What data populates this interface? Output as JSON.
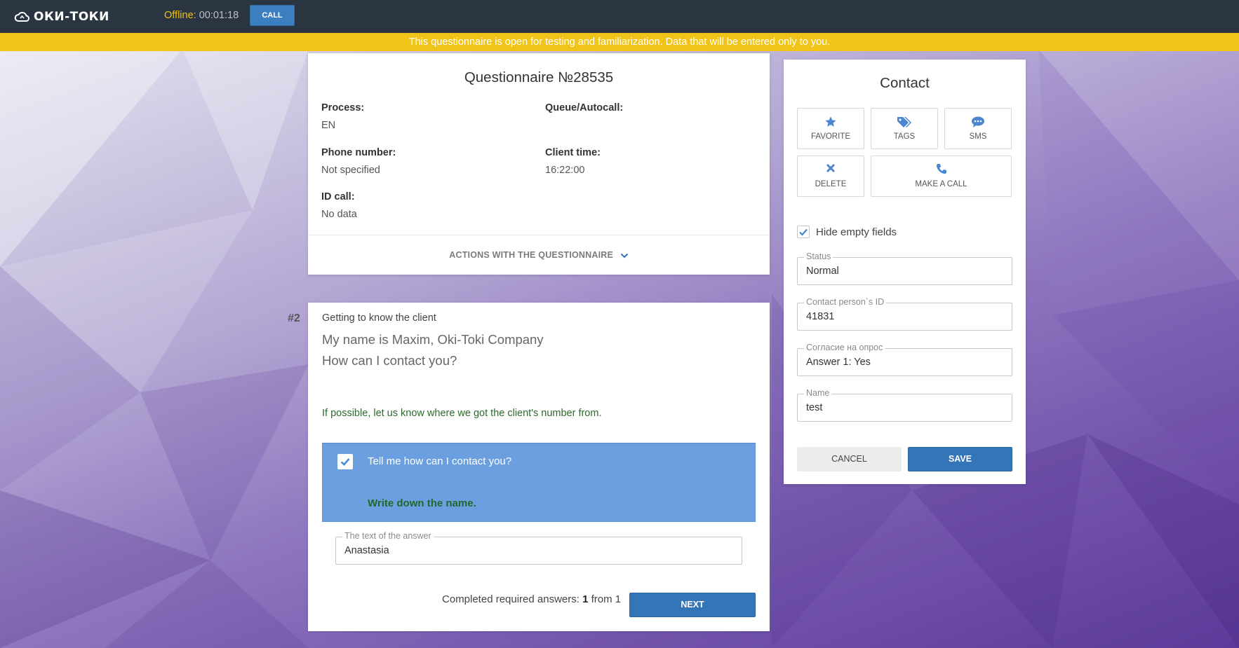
{
  "app": {
    "logo_text": "ОКИ-ТОКИ",
    "offline_label": "Offline:",
    "offline_time": "00:01:18",
    "call_label": "CALL"
  },
  "banner": {
    "text": "This questionnaire is open for testing and familiarization. Data that will be entered only to you.",
    "color": "#f0c419"
  },
  "questionnaire": {
    "title": "Questionnaire №28535",
    "fields": {
      "process_label": "Process:",
      "process_value": "EN",
      "queue_label": "Queue/Autocall:",
      "queue_value": "",
      "phone_label": "Phone number:",
      "phone_value": "Not specified",
      "client_time_label": "Client time:",
      "client_time_value": "16:22:00",
      "id_call_label": "ID call:",
      "id_call_value": "No data"
    },
    "actions_label": "ACTIONS WITH THE QUESTIONNAIRE"
  },
  "question": {
    "number": "#2",
    "section": "Getting to know the client",
    "text_line1": "My name is Maxim, Oki-Toki Company",
    "text_line2": "How can I contact you?",
    "hint": "If possible, let us know where we got the client's number from.",
    "answer_option": "Tell me how can I contact you?",
    "answer_instruction": "Write down the name.",
    "answer_field_label": "The text of the answer",
    "answer_field_value": "Anastasia",
    "completed_prefix": "Completed required answers:",
    "completed_count": "1",
    "completed_suffix": "from 1",
    "next_label": "NEXT"
  },
  "contact": {
    "title": "Contact",
    "buttons": {
      "favorite": "FAVORITE",
      "tags": "TAGS",
      "sms": "SMS",
      "delete": "DELETE",
      "make_call": "MAKE A CALL"
    },
    "hide_empty_label": "Hide empty fields",
    "hide_empty_checked": true,
    "fields": [
      {
        "label": "Status",
        "value": "Normal"
      },
      {
        "label": "Contact person`s ID",
        "value": "41831"
      },
      {
        "label": "Согласие на опрос",
        "value": "Answer 1: Yes"
      },
      {
        "label": "Name",
        "value": "test"
      }
    ],
    "cancel_label": "CANCEL",
    "save_label": "SAVE"
  },
  "colors": {
    "topbar": "#2b3541",
    "accent_blue": "#3475b8",
    "answer_box": "#6b9fdf",
    "offline_yellow": "#f2c10e",
    "hint_green": "#2d6a2d"
  }
}
